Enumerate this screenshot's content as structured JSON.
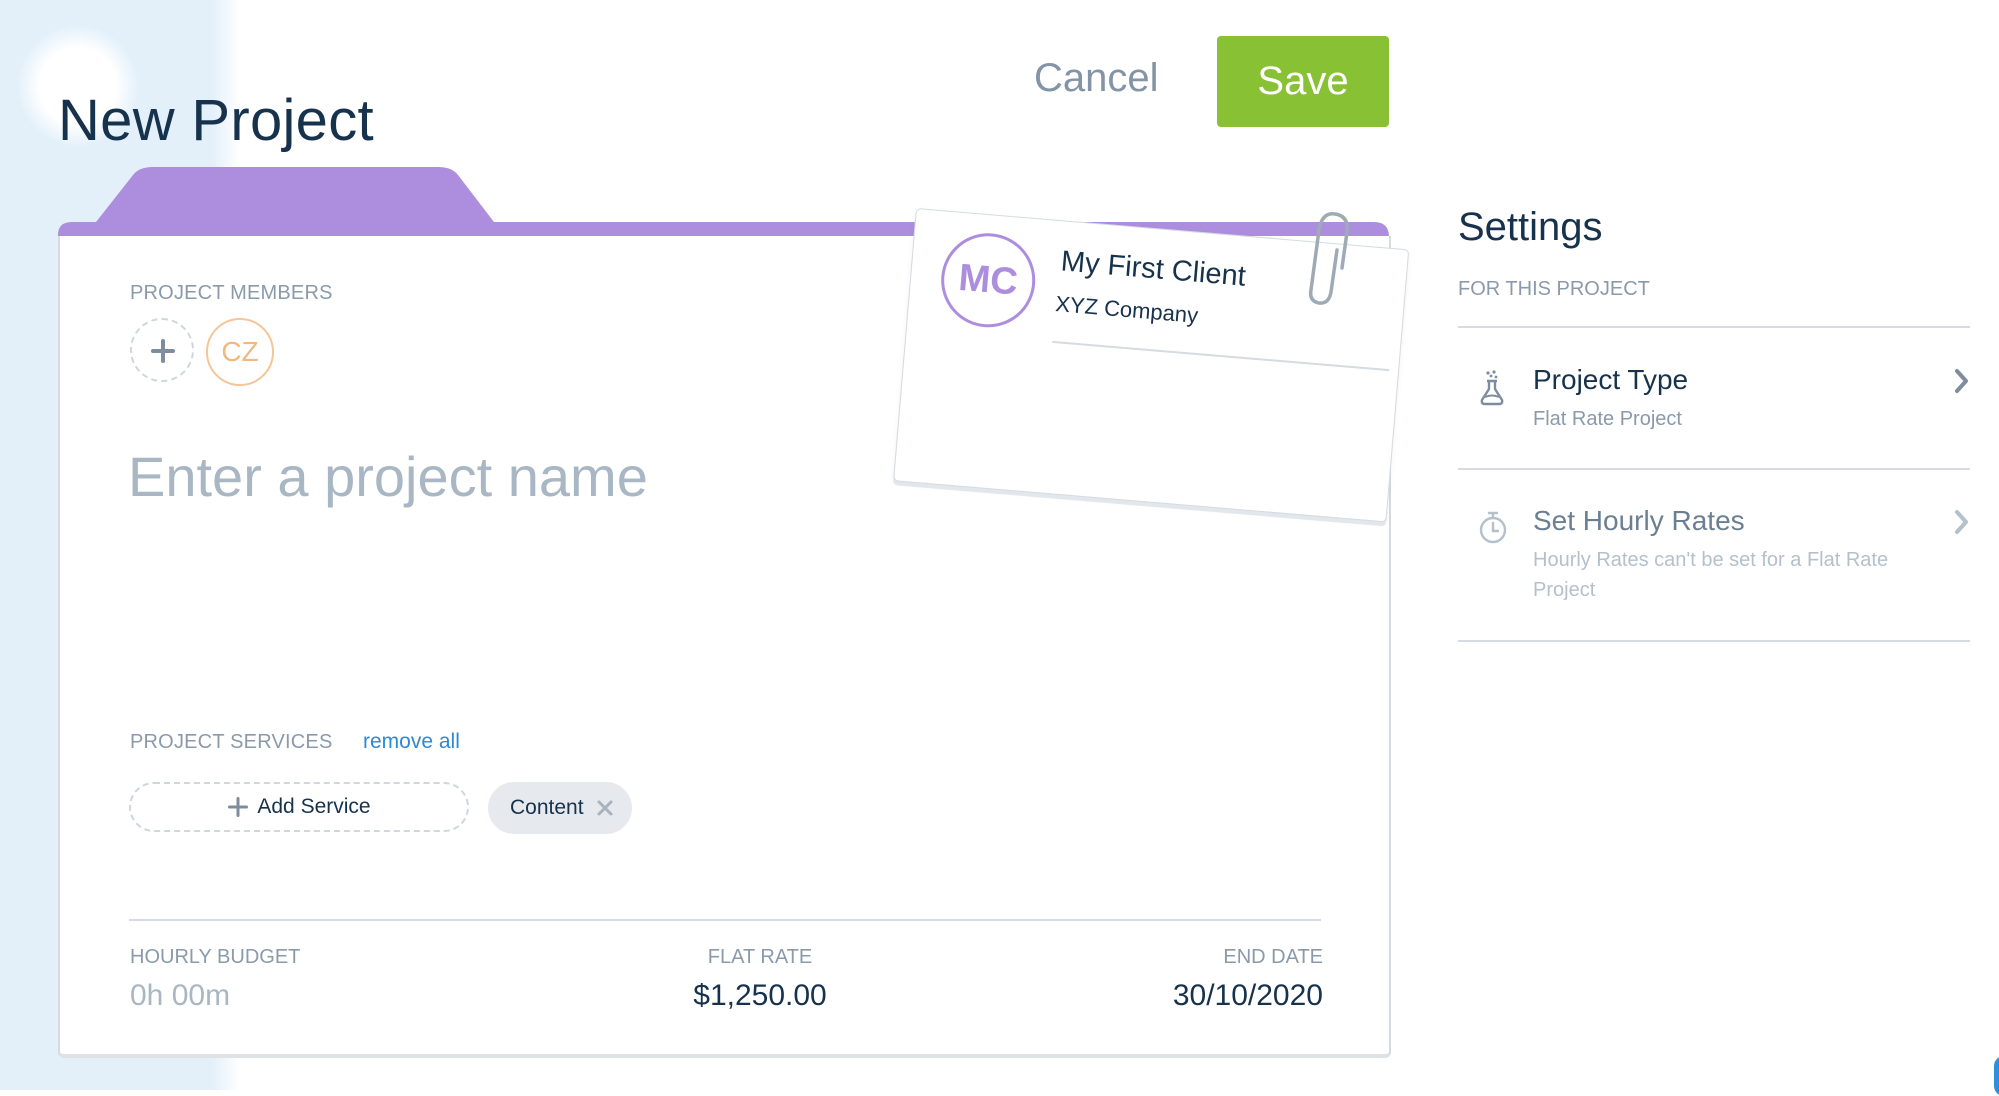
{
  "header": {
    "title": "New Project",
    "cancel_label": "Cancel",
    "save_label": "Save"
  },
  "colors": {
    "accent_green": "#88c134",
    "folder_purple": "#ad8ede",
    "link_blue": "#2b8ad6",
    "member_orange": "#f3b77f",
    "text_dark": "#17324d",
    "text_muted": "#8a9aab"
  },
  "project": {
    "members_label": "PROJECT MEMBERS",
    "add_member_icon": "plus-icon",
    "members": [
      {
        "initials": "CZ"
      }
    ],
    "name_value": "",
    "name_placeholder": "Enter a project name",
    "services_label": "PROJECT SERVICES",
    "remove_all_label": "remove all",
    "add_service_label": "Add Service",
    "services": [
      {
        "name": "Content"
      }
    ],
    "footer": {
      "hourly_budget_label": "HOURLY BUDGET",
      "hourly_budget_value": "0h 00m",
      "flat_rate_label": "FLAT RATE",
      "flat_rate_value": "$1,250.00",
      "end_date_label": "END DATE",
      "end_date_value": "30/10/2020"
    }
  },
  "client": {
    "initials": "MC",
    "name": "My First Client",
    "company": "XYZ Company"
  },
  "settings": {
    "title": "Settings",
    "subtitle": "FOR THIS PROJECT",
    "items": [
      {
        "icon": "flask-icon",
        "title": "Project Type",
        "description": "Flat Rate Project",
        "enabled": true
      },
      {
        "icon": "stopwatch-icon",
        "title": "Set Hourly Rates",
        "description": "Hourly Rates can't be set for a Flat Rate Project",
        "enabled": false
      }
    ]
  }
}
